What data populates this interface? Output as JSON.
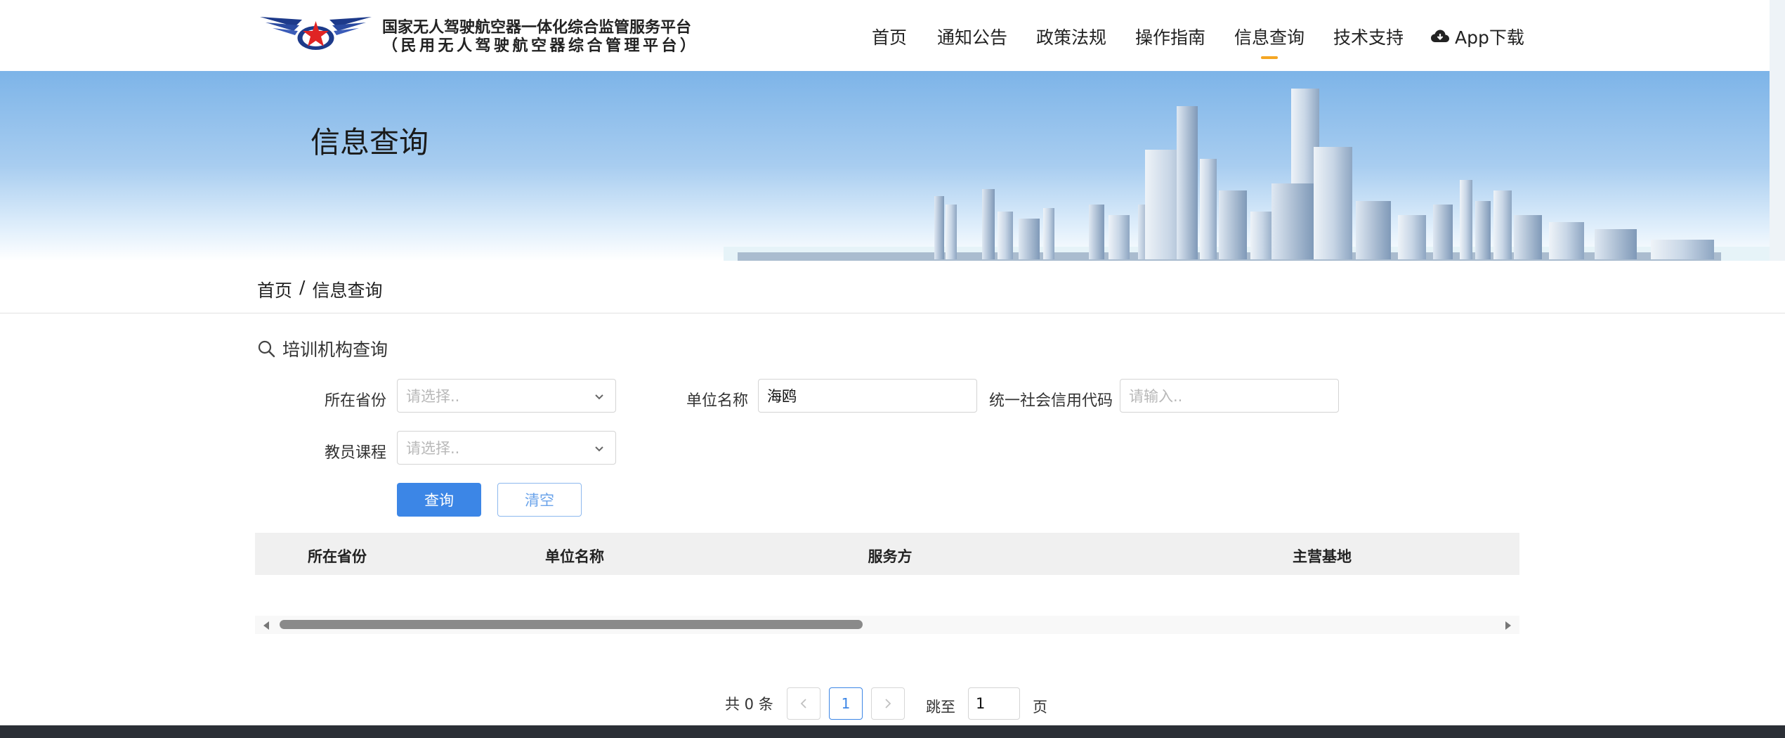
{
  "header": {
    "brand_line1": "国家无人驾驶航空器一体化综合监管服务平台",
    "brand_line2": "（民用无人驾驶航空器综合管理平台）",
    "logo_icon": "wings-star-logo-icon",
    "nav": [
      {
        "label": "首页",
        "active": false
      },
      {
        "label": "通知公告",
        "active": false
      },
      {
        "label": "政策法规",
        "active": false
      },
      {
        "label": "操作指南",
        "active": false
      },
      {
        "label": "信息查询",
        "active": true
      },
      {
        "label": "技术支持",
        "active": false
      }
    ],
    "app_download": {
      "label": "App下载",
      "icon": "cloud-download-icon"
    },
    "active_underline_color": "#f5a623"
  },
  "banner": {
    "title": "信息查询"
  },
  "breadcrumb": {
    "home": "首页",
    "separator": "/",
    "current": "信息查询"
  },
  "section": {
    "title": "培训机构查询",
    "icon": "search-icon"
  },
  "form": {
    "province_label": "所在省份",
    "province_placeholder": "请选择..",
    "unit_label": "单位名称",
    "unit_value": "海鸥",
    "credit_code_label": "统一社会信用代码",
    "credit_code_placeholder": "请输入..",
    "course_label": "教员课程",
    "course_placeholder": "请选择..",
    "query_button": "查询",
    "clear_button": "清空",
    "primary_color": "#3c86e6"
  },
  "table": {
    "columns": [
      "所在省份",
      "单位名称",
      "服务方",
      "主营基地"
    ],
    "rows": []
  },
  "pagination": {
    "total_text": "共 0 条",
    "current_page": "1",
    "jump_label": "跳至",
    "jump_value": "1",
    "page_unit": "页"
  }
}
